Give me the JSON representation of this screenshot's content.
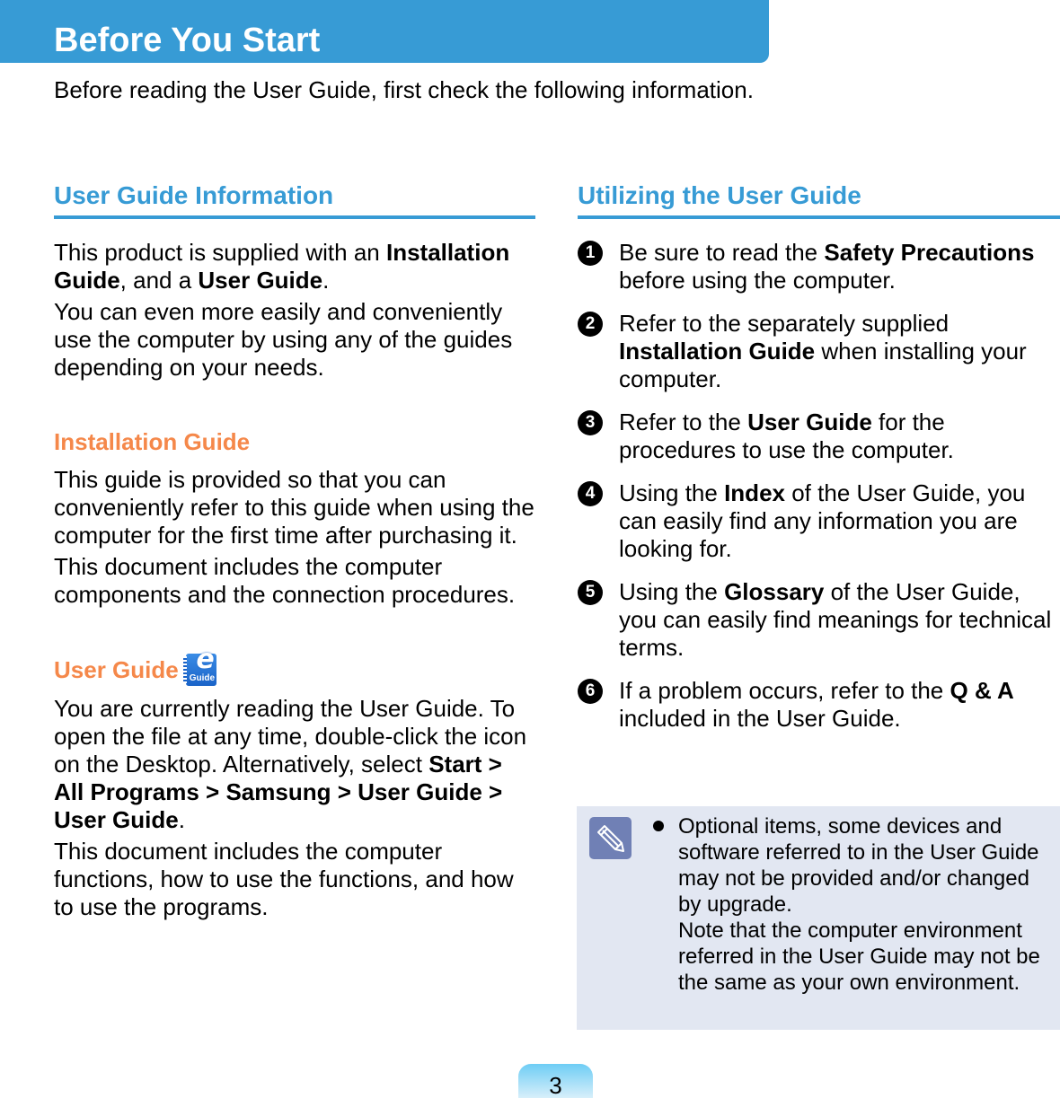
{
  "header": {
    "title": "Before You Start",
    "intro": "Before reading the User Guide, first check the following information."
  },
  "left": {
    "heading": "User Guide Information",
    "p1": [
      {
        "t": "This product is supplied with an ",
        "b": false
      },
      {
        "t": "Installation Guide",
        "b": true
      },
      {
        "t": ", and a ",
        "b": false
      },
      {
        "t": "User Guide",
        "b": true
      },
      {
        "t": ".",
        "b": false
      }
    ],
    "p2": "You can even more easily and conveniently use the computer by using any of the guides depending on your needs.",
    "installation": {
      "heading": "Installation Guide",
      "p1": "This guide is provided so that you can conveniently refer to this guide when using the computer for the first time after purchasing it.",
      "p2": "This document includes the computer components and the connection procedures."
    },
    "user_guide": {
      "heading": "User Guide",
      "icon": "e-guide-icon",
      "icon_label": "Guide",
      "p1": [
        {
          "t": "You are currently reading the User Guide. To open the file at any time, double-click the icon on the Desktop. Alternatively, select ",
          "b": false
        },
        {
          "t": "Start > All Programs > Samsung > User Guide > User Guide",
          "b": true
        },
        {
          "t": ".",
          "b": false
        }
      ],
      "p2": "This document includes the computer functions, how to use the functions, and how to use the programs."
    }
  },
  "right": {
    "heading": "Utilizing the User Guide",
    "items": [
      {
        "num": "1",
        "parts": [
          {
            "t": "Be sure to read the ",
            "b": false
          },
          {
            "t": "Safety Precautions",
            "b": true
          },
          {
            "t": " before using the computer.",
            "b": false
          }
        ]
      },
      {
        "num": "2",
        "parts": [
          {
            "t": "Refer to the separately supplied ",
            "b": false
          },
          {
            "t": "Installation Guide",
            "b": true
          },
          {
            "t": " when installing your computer.",
            "b": false
          }
        ]
      },
      {
        "num": "3",
        "parts": [
          {
            "t": "Refer to the ",
            "b": false
          },
          {
            "t": "User Guide",
            "b": true
          },
          {
            "t": " for the procedures to use the computer.",
            "b": false
          }
        ]
      },
      {
        "num": "4",
        "parts": [
          {
            "t": "Using the ",
            "b": false
          },
          {
            "t": "Index",
            "b": true
          },
          {
            "t": " of the User Guide, you can easily find any information you are looking for.",
            "b": false
          }
        ]
      },
      {
        "num": "5",
        "parts": [
          {
            "t": "Using the ",
            "b": false
          },
          {
            "t": "Glossary",
            "b": true
          },
          {
            "t": " of the User Guide, you can easily find meanings for technical terms.",
            "b": false
          }
        ]
      },
      {
        "num": "6",
        "parts": [
          {
            "t": "If a problem occurs, refer to the ",
            "b": false
          },
          {
            "t": "Q & A",
            "b": true
          },
          {
            "t": " included in the User Guide.",
            "b": false
          }
        ]
      }
    ],
    "note": {
      "icon": "pencil-note-icon",
      "line1": "Optional items, some devices and software referred to in the User Guide may not be provided and/or changed by upgrade.",
      "line2": "Note that the computer environment referred in the User Guide may not be the same as your own environment."
    }
  },
  "footer": {
    "page_number": "3"
  },
  "colors": {
    "banner": "#379bd5",
    "section_heading": "#379bd5",
    "sub_heading": "#f5884a",
    "note_bg": "#e2e7f2",
    "note_icon": "#7080b5"
  }
}
